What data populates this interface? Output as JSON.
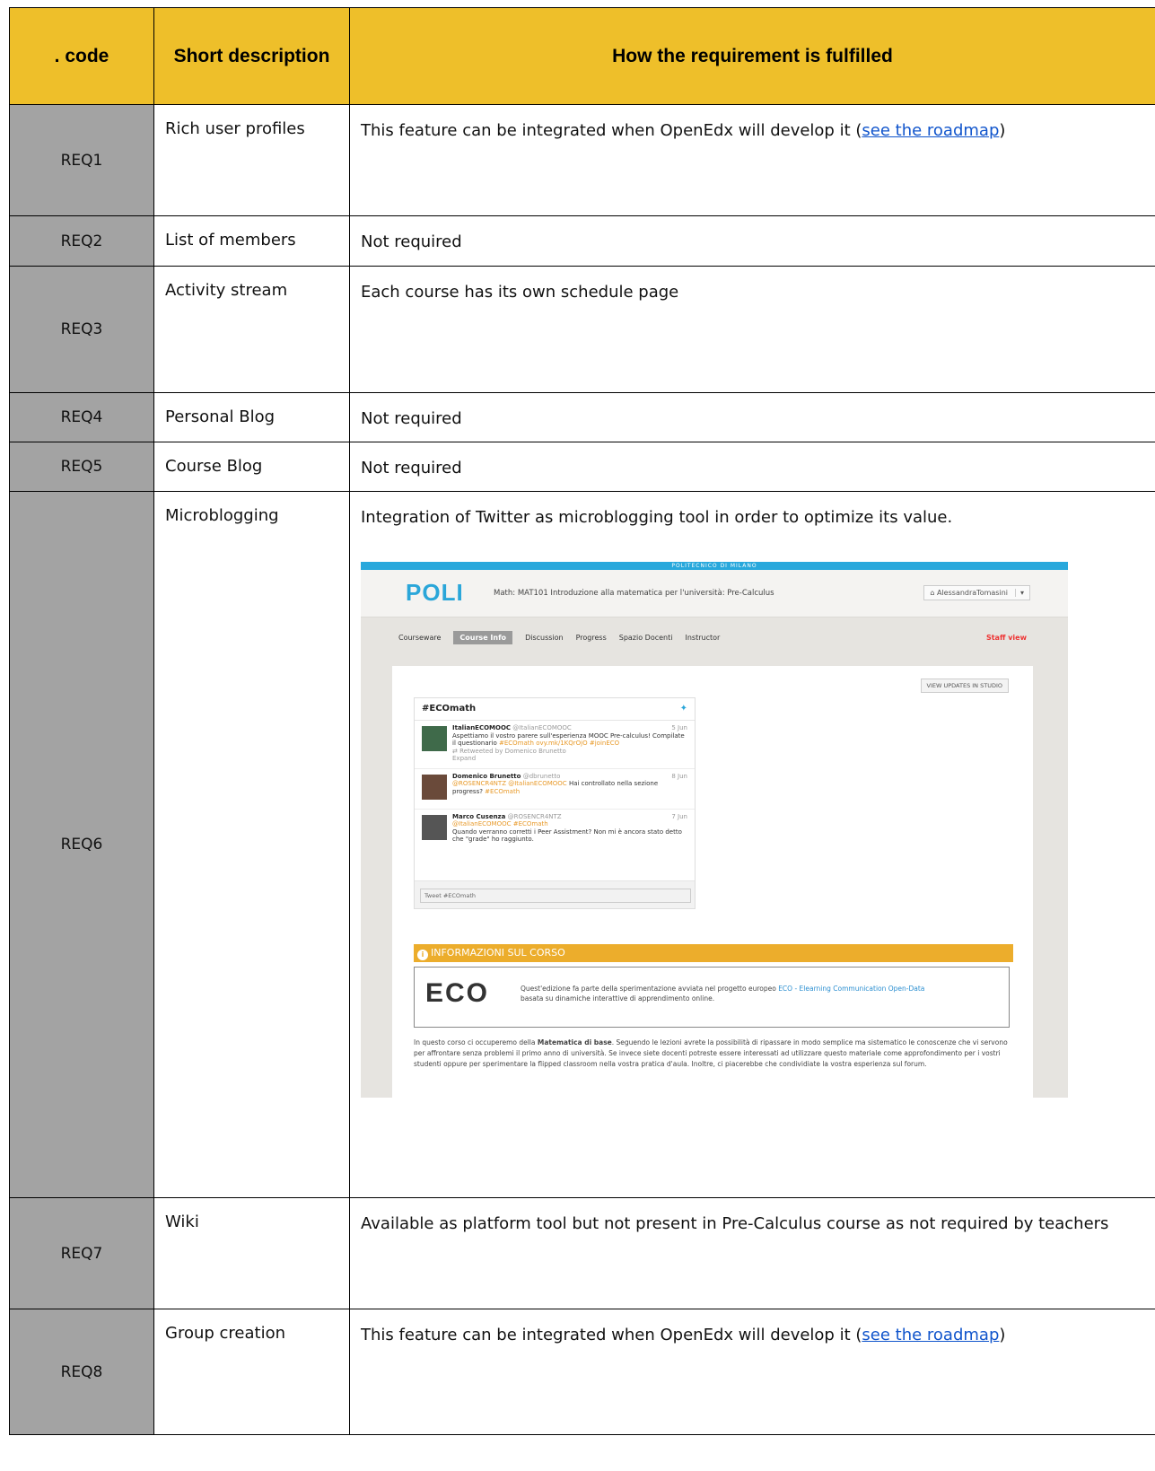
{
  "table": {
    "headers": [
      ". code",
      "Short description",
      "How the requirement is fulfilled"
    ],
    "rows": [
      {
        "code": "REQ1",
        "desc": "Rich user profiles",
        "how_prefix": "This feature can be integrated when OpenEdx will develop it (",
        "how_link": "see the roadmap",
        "how_suffix": ")"
      },
      {
        "code": "REQ2",
        "desc": "List of members",
        "how": "Not required"
      },
      {
        "code": "REQ3",
        "desc": "Activity stream",
        "how": "Each course has its own schedule page"
      },
      {
        "code": "REQ4",
        "desc": "Personal Blog",
        "how": "Not required"
      },
      {
        "code": "REQ5",
        "desc": "Course Blog",
        "how": "Not required"
      },
      {
        "code": "REQ6",
        "desc": "Microblogging",
        "how": "Integration of Twitter as microblogging tool in order to optimize its value."
      },
      {
        "code": "REQ7",
        "desc": "Wiki",
        "how": "Available as platform tool but not present in Pre-Calculus course as not required by teachers"
      },
      {
        "code": "REQ8",
        "desc": "Group creation",
        "how_prefix": "This feature can be integrated when OpenEdx will develop it (",
        "how_link": "see the roadmap",
        "how_suffix": ")"
      }
    ]
  },
  "screenshot": {
    "topbar": "POLITECNICO DI MILANO",
    "logo": "POLI",
    "course_title": "Math: MAT101 Introduzione alla matematica per l'università: Pre-Calculus",
    "user": "AlessandraTomasini",
    "nav": [
      "Courseware",
      "Course Info",
      "Discussion",
      "Progress",
      "Spazio Docenti",
      "Instructor"
    ],
    "staff_view": "Staff view",
    "view_updates": "VIEW UPDATES IN STUDIO",
    "twitter": {
      "hashtag": "#ECOmath",
      "tweets": [
        {
          "name": "ItalianECOMOOC",
          "handle": "@ItalianECOMOOC",
          "date": "5 Jun",
          "text": "Aspettiamo il vostro parere sull'esperienza MOOC Pre-calculus! Compilate il questionario",
          "tags": "#ECOmath ovy.mk/1KQrOjO #joinECO",
          "meta": "Retweeted by Domenico Brunetto",
          "expand": "Expand"
        },
        {
          "name": "Domenico Brunetto",
          "handle": "@dbrunetto",
          "date": "8 Jun",
          "tags": "@ROSENCR4NTZ @ItalianECOMOOC",
          "text": "Hai controllato nella sezione progress?",
          "tags2": "#ECOmath"
        },
        {
          "name": "Marco Cusenza",
          "handle": "@ROSENCR4NTZ",
          "date": "7 Jun",
          "tags": "@ItalianECOMOOC #ECOmath",
          "text": "Quando verranno corretti i Peer Assistment? Non mi è ancora stato detto che \"grade\" ho raggiunto."
        }
      ],
      "input_placeholder": "Tweet #ECOmath"
    },
    "info_title": "INFORMAZIONI SUL CORSO",
    "eco_logo": "ECO",
    "eco_text_prefix": "Quest'edizione fa parte della sperimentazione avviata nel progetto europeo",
    "eco_text_link": "ECO - Elearning Communication Open-Data",
    "eco_text_suffix": "basata su dinamiche interattive di apprendimento online.",
    "paragraph_prefix": "In questo corso ci occuperemo della",
    "paragraph_bold": "Matematica di base",
    "paragraph_suffix": ". Seguendo le lezioni avrete la possibilità di ripassare in modo semplice ma sistematico le conoscenze che vi servono per affrontare senza problemi il primo anno di università. Se invece siete docenti potreste essere interessati ad utilizzare questo materiale come approfondimento per i vostri studenti oppure per sperimentare la flipped classroom nella vostra pratica d'aula. Inoltre, ci piacerebbe che condividiate la vostra esperienza sul forum."
  }
}
